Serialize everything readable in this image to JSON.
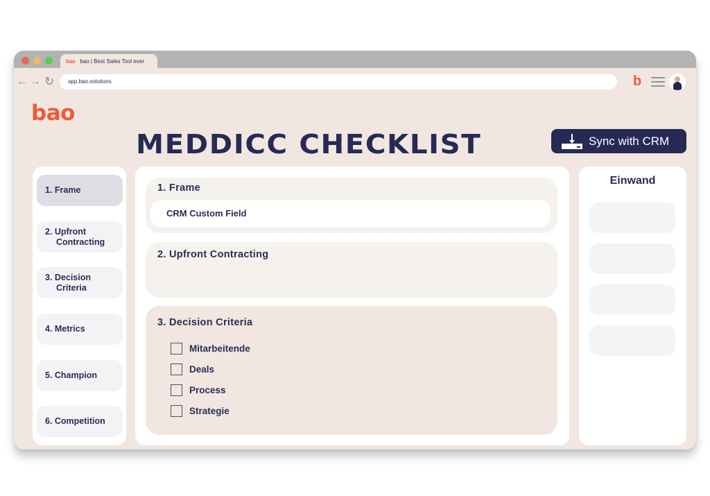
{
  "browser": {
    "tab_logo": "bao",
    "tab_title": "bao | Best Sales Tool ever",
    "url": "app.bao.solutions",
    "extension_icon": "b",
    "nav": {
      "back": "←",
      "forward": "→",
      "reload": "↻"
    }
  },
  "app": {
    "logo": "bao",
    "title": "MEDDICC CHECKLIST",
    "sync_button": "Sync with CRM"
  },
  "sidebar": {
    "items": [
      {
        "line1": "1. Frame",
        "line2": "",
        "active": true
      },
      {
        "line1": "2. Upfront",
        "line2": "Contracting",
        "active": false
      },
      {
        "line1": "3. Decision",
        "line2": "Criteria",
        "active": false
      },
      {
        "line1": "4. Metrics",
        "line2": "",
        "active": false
      },
      {
        "line1": "5. Champion",
        "line2": "",
        "active": false
      },
      {
        "line1": "6. Competition",
        "line2": "",
        "active": false
      }
    ]
  },
  "main": {
    "sections": [
      {
        "title": "1. Frame",
        "field_value": "CRM Custom Field"
      },
      {
        "title": "2. Upfront Contracting"
      },
      {
        "title": "3. Decision Criteria",
        "checklist": [
          {
            "label": "Mitarbeitende",
            "checked": false
          },
          {
            "label": "Deals",
            "checked": false
          },
          {
            "label": "Process",
            "checked": false
          },
          {
            "label": "Strategie",
            "checked": false
          }
        ]
      }
    ]
  },
  "objections": {
    "title": "Einwand",
    "slot_count": 4
  },
  "colors": {
    "brand_orange": "#f05a3a",
    "navy": "#262a55",
    "background": "#f1e7e0"
  }
}
